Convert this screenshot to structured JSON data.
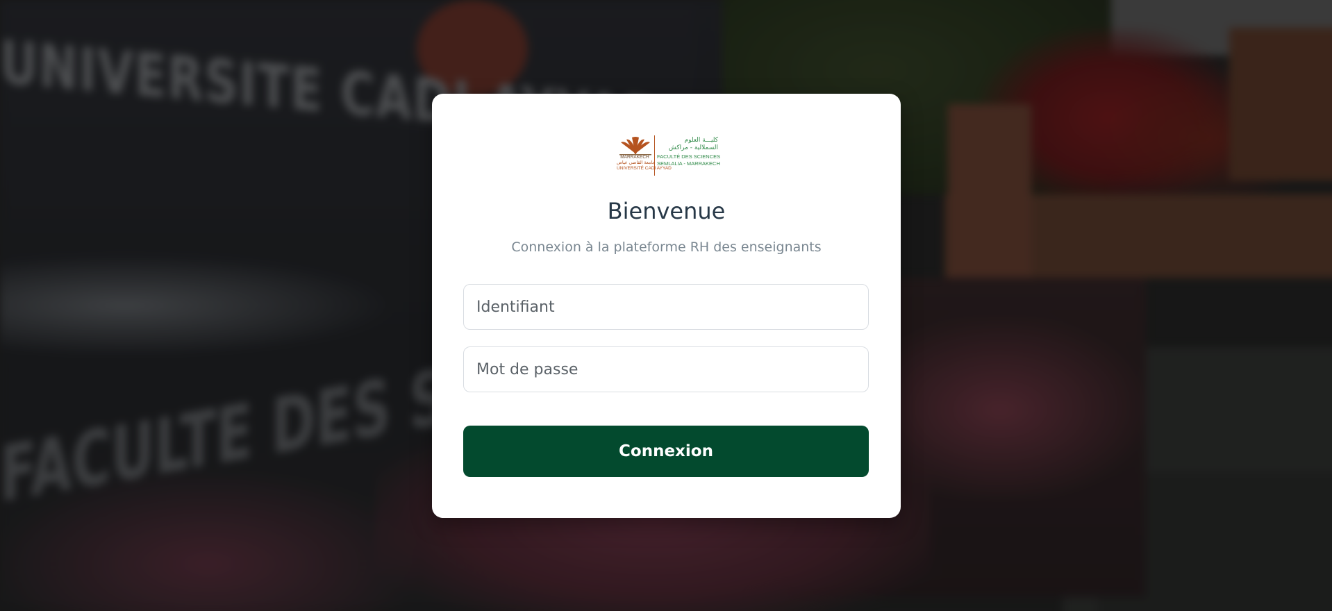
{
  "background": {
    "wall_text_top": "UNIVERSITE CADI AYYAD",
    "wall_text_bottom": "FACULTE DES S"
  },
  "logo": {
    "arabic_line1": "كليـــة العلوم",
    "arabic_line2": "السملالية - مراكش",
    "french_line1": "FACULTÉ DES SCIENCES",
    "french_line2": "SEMLALIA - MARRAKECH",
    "caption_line1": "MARRAKECH",
    "caption_line2": "جامعة القاضي عياض",
    "caption_line3": "UNIVERSITÉ CADI AYYAD",
    "colors": {
      "emblem": "#b5531f",
      "text": "#2f8a48"
    }
  },
  "login": {
    "title": "Bienvenue",
    "subtitle": "Connexion à la plateforme RH des enseignants",
    "username_placeholder": "Identifiant",
    "username_value": "",
    "password_placeholder": "Mot de passe",
    "password_value": "",
    "submit_label": "Connexion"
  },
  "colors": {
    "accent": "#034a2e",
    "title": "#273847",
    "subtitle": "#7a8791"
  }
}
